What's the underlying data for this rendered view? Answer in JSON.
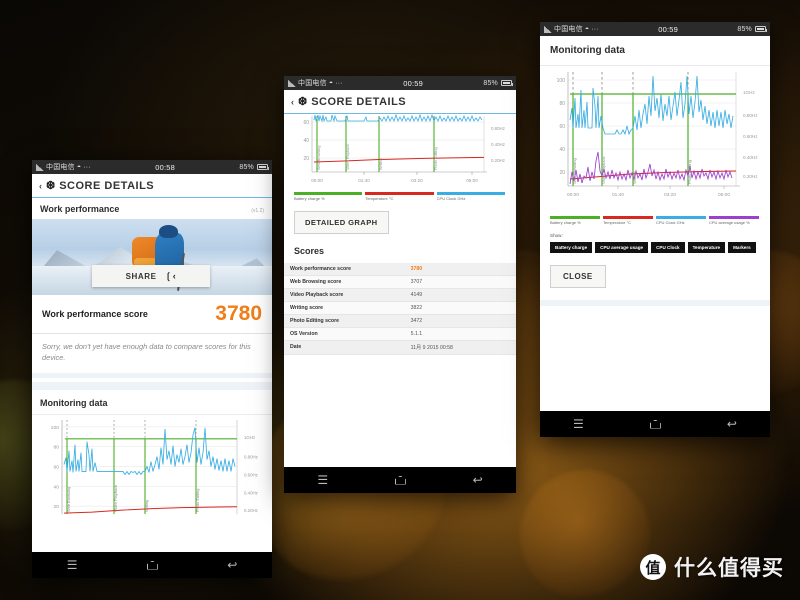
{
  "background": {
    "base_color": "#0a0805",
    "bokeh_color": "#ffa528"
  },
  "watermark": {
    "badge": "值",
    "text": "什么值得买"
  },
  "common": {
    "carrier": "中国电信",
    "battery_text": "85%",
    "nav": {
      "recent": "recent-apps",
      "home": "home",
      "back": "back"
    }
  },
  "phone1": {
    "status": {
      "carrier": "中国电信",
      "time": "00:58",
      "battery": "85%"
    },
    "appbar": {
      "back": "‹",
      "icon": "❆",
      "title": "SCORE DETAILS"
    },
    "work_performance": {
      "title": "Work performance",
      "version": "(v1.2)"
    },
    "share_button": {
      "label": "SHARE",
      "icon": "share-icon"
    },
    "score": {
      "label": "Work performance score",
      "value": "3780"
    },
    "note": "Sorry, we don't yet have enough data to compare scores for this device.",
    "monitoring": {
      "title": "Monitoring data"
    }
  },
  "phone2": {
    "status": {
      "carrier": "中国电信",
      "time": "00:59",
      "battery": "85%"
    },
    "appbar": {
      "back": "‹",
      "icon": "❆",
      "title": "SCORE DETAILS"
    },
    "detailed_graph_button": "DETAILED GRAPH",
    "scores_title": "Scores",
    "table": {
      "rows": [
        {
          "key": "Work performance score",
          "value": "3780",
          "highlight": true
        },
        {
          "key": "Web Browsing score",
          "value": "3707",
          "highlight": false
        },
        {
          "key": "Video Playback score",
          "value": "4149",
          "highlight": false
        },
        {
          "key": "Writing score",
          "value": "3822",
          "highlight": false
        },
        {
          "key": "Photo Editing score",
          "value": "3472",
          "highlight": false
        },
        {
          "key": "OS Version",
          "value": "5.1.1",
          "highlight": false
        },
        {
          "key": "Date",
          "value": "11月 9 2015 00:58",
          "highlight": false
        }
      ]
    }
  },
  "phone3": {
    "status": {
      "carrier": "中国电信",
      "time": "00:59",
      "battery": "85%"
    },
    "title": "Monitoring data",
    "show_label": "Show:",
    "show_buttons": [
      "Battery charge",
      "CPU average usage",
      "CPU Clock",
      "Temperature",
      "Markers"
    ],
    "close_button": "CLOSE"
  },
  "chart_data": {
    "type": "line",
    "title": "Monitoring data",
    "xlabel": "",
    "ylabel": "",
    "x_ticks": [
      "00:00",
      "01:40",
      "03:20",
      "05:00"
    ],
    "xlim": [
      0,
      330
    ],
    "y_left_ticks": [
      20,
      40,
      60,
      80,
      100
    ],
    "y_left_label": "%",
    "ylim": [
      10,
      105
    ],
    "y_right_ticks": [
      "0.20GHz",
      "0.40GHz",
      "0.60GHz",
      "0.80GHz",
      "1GHz"
    ],
    "grid": true,
    "legend_position": "bottom",
    "markers": [
      {
        "label": "Web Browsing",
        "x": 8
      },
      {
        "label": "Video Playback",
        "x": 92
      },
      {
        "label": "Writing",
        "x": 152
      },
      {
        "label": "Photo Editing",
        "x": 250
      }
    ],
    "series": [
      {
        "name": "Battery charge %",
        "color": "#4caf28",
        "value": 85,
        "style": "step"
      },
      {
        "name": "Temperature °C",
        "color": "#d8281f",
        "values": [
          17,
          17.5,
          18,
          18.5,
          19,
          19.2,
          19.5,
          19.8,
          20,
          20
        ]
      },
      {
        "name": "CPU Clock GHz",
        "color": "#3aade3",
        "mean_pct": 62,
        "min_pct": 55,
        "max_pct": 100
      },
      {
        "name": "CPU average usage %",
        "color": "#9a3fd0",
        "mean_pct": 17,
        "min_pct": 11,
        "max_pct": 38
      }
    ]
  }
}
